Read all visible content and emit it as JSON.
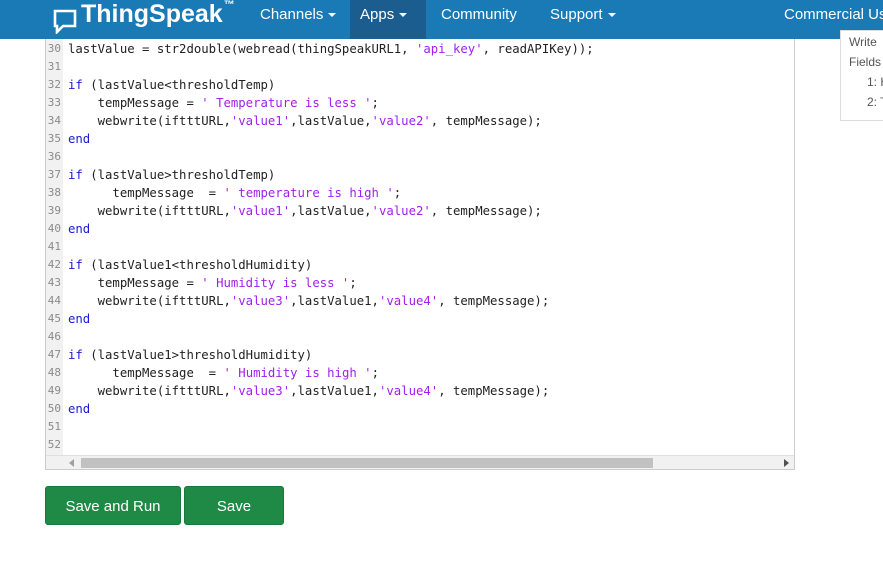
{
  "navbar": {
    "brand": "ThingSpeak",
    "brand_tm": "™",
    "items": [
      {
        "label": "Channels",
        "dropdown": true
      },
      {
        "label": "Apps",
        "dropdown": true,
        "active": true
      },
      {
        "label": "Community",
        "dropdown": false
      },
      {
        "label": "Support",
        "dropdown": true
      },
      {
        "label": "Commercial Us",
        "dropdown": false
      }
    ]
  },
  "side_panel": {
    "write": "Write",
    "fields": "Fields",
    "f1": "1: H",
    "f2": "2: T"
  },
  "editor": {
    "lines": [
      {
        "n": "30",
        "parts": [
          [
            "lastValue = str2double(webread(thingSpeakURL1, ",
            "t"
          ],
          [
            "'api_key'",
            "s"
          ],
          [
            ", readAPIKey));",
            "t"
          ]
        ]
      },
      {
        "n": "31",
        "parts": []
      },
      {
        "n": "32",
        "parts": [
          [
            "if",
            "k"
          ],
          [
            " (lastValue<thresholdTemp)",
            "t"
          ]
        ]
      },
      {
        "n": "33",
        "parts": [
          [
            "    tempMessage = ",
            "t"
          ],
          [
            "' Temperature is less '",
            "s"
          ],
          [
            ";",
            "t"
          ]
        ]
      },
      {
        "n": "34",
        "parts": [
          [
            "    webwrite(iftttURL,",
            "t"
          ],
          [
            "'value1'",
            "s"
          ],
          [
            ",lastValue,",
            "t"
          ],
          [
            "'value2'",
            "s"
          ],
          [
            ", tempMessage);",
            "t"
          ]
        ]
      },
      {
        "n": "35",
        "parts": [
          [
            "end",
            "k"
          ]
        ]
      },
      {
        "n": "36",
        "parts": []
      },
      {
        "n": "37",
        "parts": [
          [
            "if",
            "k"
          ],
          [
            " (lastValue>thresholdTemp)",
            "t"
          ]
        ]
      },
      {
        "n": "38",
        "parts": [
          [
            "      tempMessage  = ",
            "t"
          ],
          [
            "' temperature is high '",
            "s"
          ],
          [
            ";",
            "t"
          ]
        ]
      },
      {
        "n": "39",
        "parts": [
          [
            "    webwrite(iftttURL,",
            "t"
          ],
          [
            "'value1'",
            "s"
          ],
          [
            ",lastValue,",
            "t"
          ],
          [
            "'value2'",
            "s"
          ],
          [
            ", tempMessage);",
            "t"
          ]
        ]
      },
      {
        "n": "40",
        "parts": [
          [
            "end",
            "k"
          ]
        ]
      },
      {
        "n": "41",
        "parts": []
      },
      {
        "n": "42",
        "parts": [
          [
            "if",
            "k"
          ],
          [
            " (lastValue1<thresholdHumidity)",
            "t"
          ]
        ]
      },
      {
        "n": "43",
        "parts": [
          [
            "    tempMessage = ",
            "t"
          ],
          [
            "' Humidity is less '",
            "s"
          ],
          [
            ";",
            "t"
          ]
        ]
      },
      {
        "n": "44",
        "parts": [
          [
            "    webwrite(iftttURL,",
            "t"
          ],
          [
            "'value3'",
            "s"
          ],
          [
            ",lastValue1,",
            "t"
          ],
          [
            "'value4'",
            "s"
          ],
          [
            ", tempMessage);",
            "t"
          ]
        ]
      },
      {
        "n": "45",
        "parts": [
          [
            "end",
            "k"
          ]
        ]
      },
      {
        "n": "46",
        "parts": []
      },
      {
        "n": "47",
        "parts": [
          [
            "if",
            "k"
          ],
          [
            " (lastValue1>thresholdHumidity)",
            "t"
          ]
        ]
      },
      {
        "n": "48",
        "parts": [
          [
            "      tempMessage  = ",
            "t"
          ],
          [
            "' Humidity is high '",
            "s"
          ],
          [
            ";",
            "t"
          ]
        ]
      },
      {
        "n": "49",
        "parts": [
          [
            "    webwrite(iftttURL,",
            "t"
          ],
          [
            "'value3'",
            "s"
          ],
          [
            ",lastValue1,",
            "t"
          ],
          [
            "'value4'",
            "s"
          ],
          [
            ", tempMessage);",
            "t"
          ]
        ]
      },
      {
        "n": "50",
        "parts": [
          [
            "end",
            "k"
          ]
        ]
      },
      {
        "n": "51",
        "parts": []
      },
      {
        "n": "52",
        "parts": []
      }
    ]
  },
  "buttons": {
    "save_and_run": "Save and Run",
    "save": "Save"
  },
  "colors": {
    "navbar": "#1a7ab6",
    "navbar_active": "#1a5d8e",
    "keyword": "#1b1bd0",
    "string": "#a020f0",
    "button": "#1e8a45"
  }
}
